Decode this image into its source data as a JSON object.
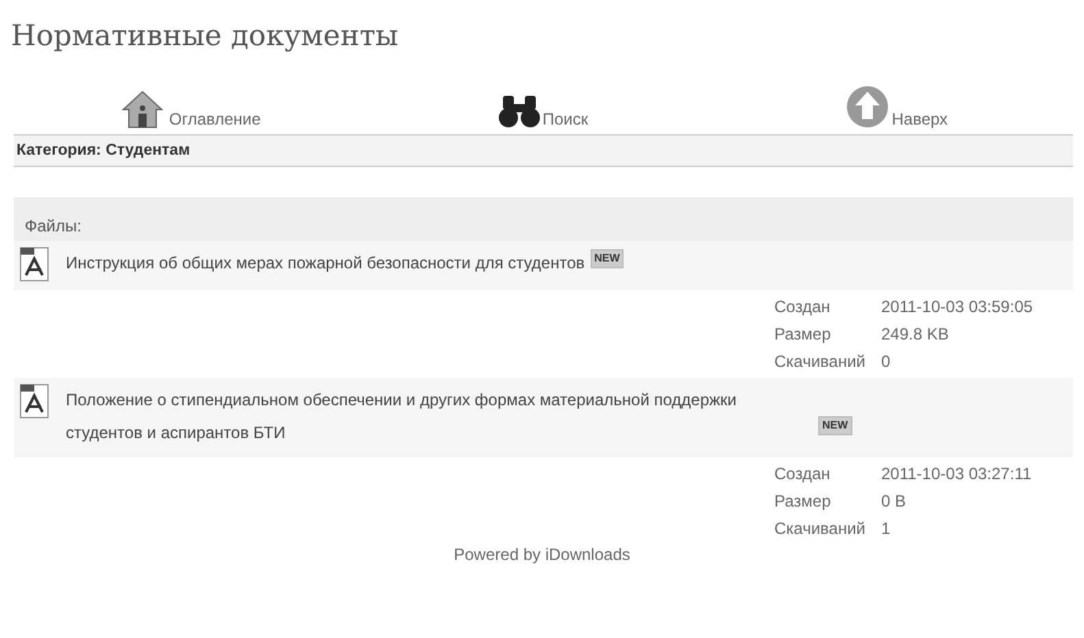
{
  "page_title": "Нормативные документы",
  "nav": [
    {
      "kind": "home",
      "label": "Оглавление"
    },
    {
      "kind": "search",
      "label": "Поиск"
    },
    {
      "kind": "up",
      "label": "Наверх"
    }
  ],
  "category": "Категория: Студентам",
  "files_heading": "Файлы:",
  "files": [
    {
      "title": "Инструкция об общих мерах пожарной безопасности для студентов",
      "badge": "NEW",
      "details": [
        {
          "label": "Создан",
          "value": "2011-10-03 03:59:05"
        },
        {
          "label": "Размер",
          "value": "249.8 KB"
        },
        {
          "label": "Скачиваний",
          "value": "0"
        }
      ]
    },
    {
      "title": "Положение о стипендиальном обеспечении и других формах материальной поддержки студентов и аспирантов БТИ",
      "badge": "NEW",
      "details": [
        {
          "label": "Создан",
          "value": "2011-10-03 03:27:11"
        },
        {
          "label": "Размер",
          "value": "0 B"
        },
        {
          "label": "Скачиваний",
          "value": "1"
        }
      ]
    }
  ],
  "footer": "Powered by iDownloads"
}
